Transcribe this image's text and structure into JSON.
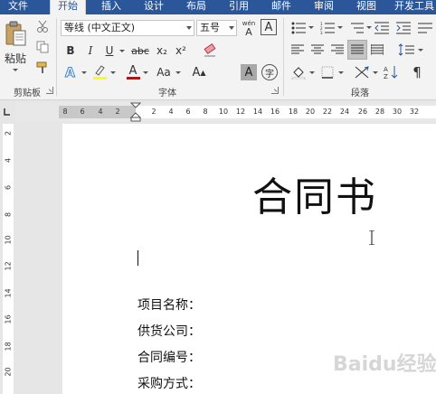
{
  "tabs": [
    {
      "label": "文件",
      "active": false
    },
    {
      "label": "开始",
      "active": true
    },
    {
      "label": "插入",
      "active": false
    },
    {
      "label": "设计",
      "active": false
    },
    {
      "label": "布局",
      "active": false
    },
    {
      "label": "引用",
      "active": false
    },
    {
      "label": "邮件",
      "active": false
    },
    {
      "label": "审阅",
      "active": false
    },
    {
      "label": "视图",
      "active": false
    },
    {
      "label": "开发工具",
      "active": false
    }
  ],
  "ribbon": {
    "clipboard": {
      "paste_label": "粘贴",
      "group_label": "剪贴板"
    },
    "font": {
      "font_name": "等线 (中文正文)",
      "font_size": "五号",
      "bold": "B",
      "italic": "I",
      "underline": "U",
      "strike": "abc",
      "subscript": "x₂",
      "superscript": "x²",
      "char_shading": "A",
      "enclose": "字",
      "phonetic_top": "wén",
      "phonetic_bottom": "A",
      "font_color_letter": "A",
      "change_case": "Aa",
      "group_label": "字体"
    },
    "paragraph": {
      "group_label": "段落"
    }
  },
  "ruler": {
    "horizontal_labels": [
      "8",
      "6",
      "4",
      "2",
      "2",
      "4",
      "6",
      "8",
      "10",
      "12",
      "14",
      "16",
      "18",
      "20",
      "22",
      "24",
      "26",
      "28",
      "30",
      "32"
    ],
    "vertical_labels": [
      "2",
      "4",
      "6",
      "8",
      "10",
      "12",
      "14",
      "16",
      "18",
      "20"
    ]
  },
  "document": {
    "title": "合同书",
    "fields": [
      "项目名称：",
      "供货公司：",
      "合同编号：",
      "采购方式："
    ]
  },
  "watermark": "Baidu经验",
  "colors": {
    "tab_bar": "#2b579a",
    "highlight_yellow": "#ffff00",
    "font_red": "#e00000"
  }
}
